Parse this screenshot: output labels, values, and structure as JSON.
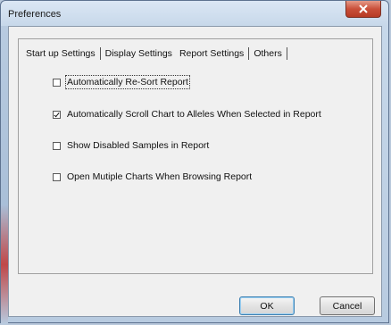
{
  "window": {
    "title": "Preferences"
  },
  "tabs": [
    {
      "label": "Start up Settings",
      "active": false
    },
    {
      "label": "Display Settings",
      "active": false
    },
    {
      "label": "Report Settings",
      "active": true
    },
    {
      "label": "Others",
      "active": false
    }
  ],
  "options": [
    {
      "label": "Automatically Re-Sort Report",
      "checked": false
    },
    {
      "label": "Automatically Scroll Chart to Alleles When Selected in Report",
      "checked": true
    },
    {
      "label": "Show Disabled Samples in Report",
      "checked": false
    },
    {
      "label": "Open Mutiple Charts When Browsing Report",
      "checked": false
    }
  ],
  "buttons": {
    "ok_label": "OK",
    "cancel_label": "Cancel"
  }
}
